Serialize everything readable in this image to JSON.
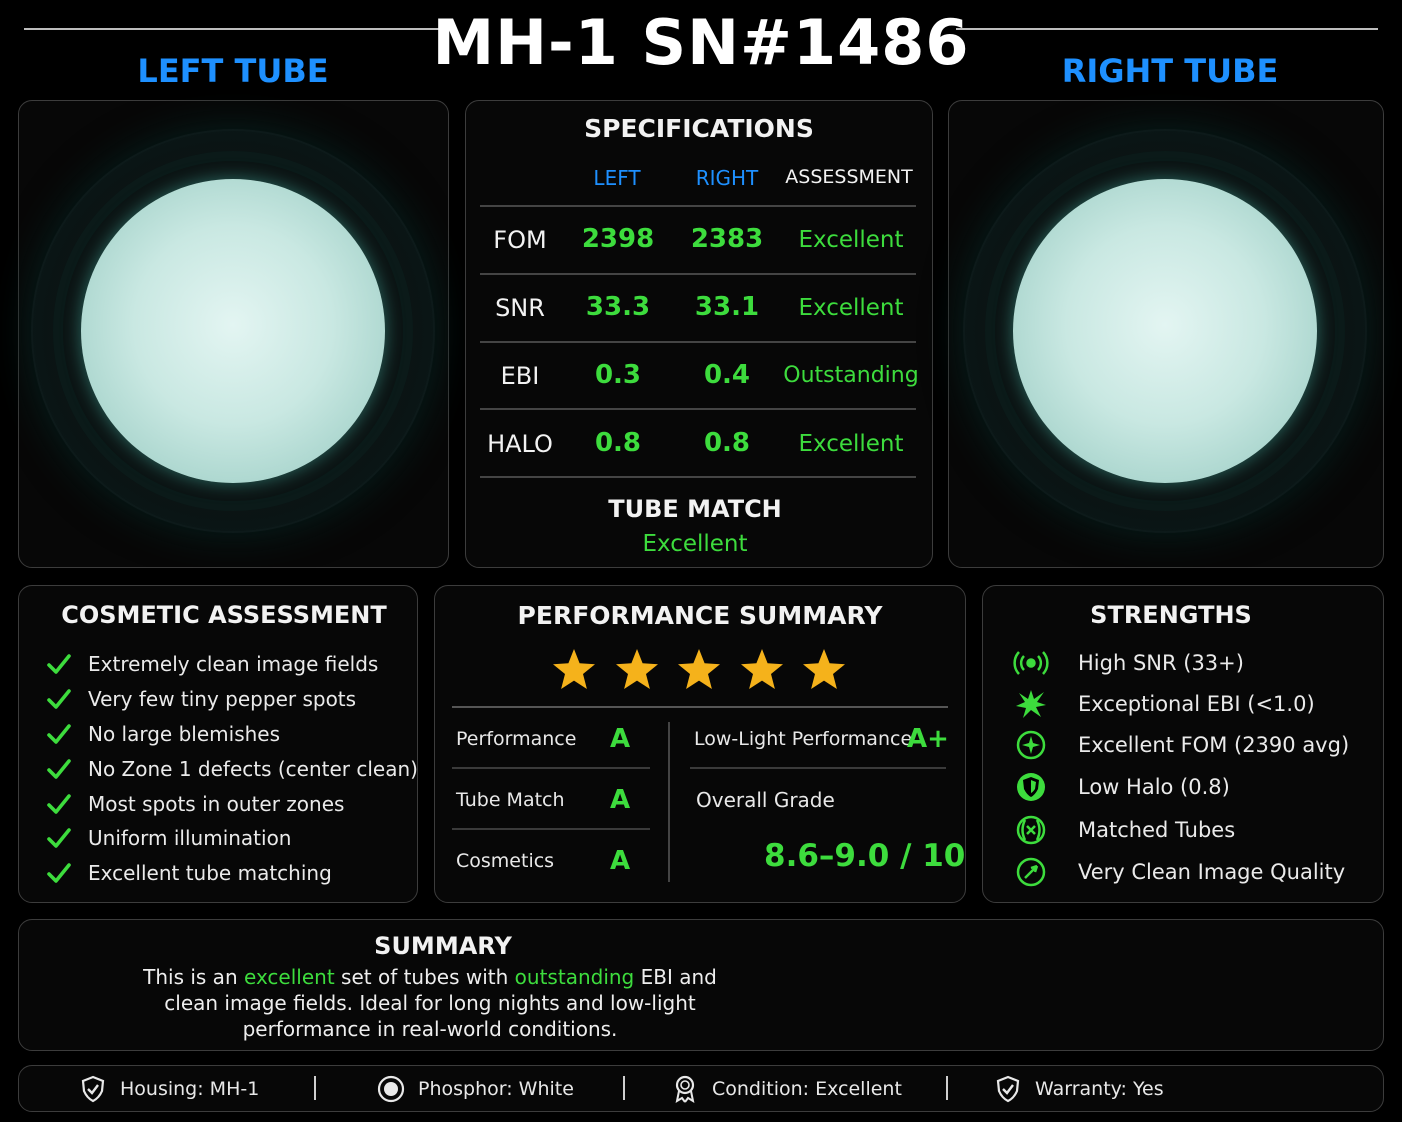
{
  "title": "MH-1 SN#1486",
  "left_tube_label": "LEFT TUBE",
  "right_tube_label": "RIGHT TUBE",
  "specs": {
    "heading": "SPECIFICATIONS",
    "col_left": "LEFT",
    "col_right": "RIGHT",
    "col_assessment": "ASSESSMENT",
    "rows": [
      {
        "label": "FOM",
        "left": "2398",
        "right": "2383",
        "assessment": "Excellent"
      },
      {
        "label": "SNR",
        "left": "33.3",
        "right": "33.1",
        "assessment": "Excellent"
      },
      {
        "label": "EBI",
        "left": "0.3",
        "right": "0.4",
        "assessment": "Outstanding"
      },
      {
        "label": "HALO",
        "left": "0.8",
        "right": "0.8",
        "assessment": "Excellent"
      }
    ],
    "tube_match_label": "TUBE MATCH",
    "tube_match_value": "Excellent"
  },
  "cosmetic": {
    "heading": "COSMETIC ASSESSMENT",
    "items": [
      "Extremely clean image fields",
      "Very few tiny pepper spots",
      "No large blemishes",
      "No Zone 1 defects (center clean)",
      "Most spots in outer zones",
      "Uniform illumination",
      "Excellent tube matching"
    ]
  },
  "performance": {
    "heading": "PERFORMANCE SUMMARY",
    "stars": 5,
    "grades_left": [
      {
        "label": "Performance",
        "grade": "A"
      },
      {
        "label": "Tube Match",
        "grade": "A"
      },
      {
        "label": "Cosmetics",
        "grade": "A"
      }
    ],
    "lowlight_label": "Low-Light Performance",
    "lowlight_grade": "A+",
    "overall_label": "Overall Grade",
    "overall_value": "8.6–9.0 / 10"
  },
  "strengths": {
    "heading": "STRENGTHS",
    "items": [
      {
        "icon": "signal-icon",
        "text": "High SNR (33+)"
      },
      {
        "icon": "burst-icon",
        "text": "Exceptional EBI (<1.0)"
      },
      {
        "icon": "compass-icon",
        "text": "Excellent FOM (2390 avg)"
      },
      {
        "icon": "shield-icon",
        "text": "Low Halo (0.8)"
      },
      {
        "icon": "match-icon",
        "text": "Matched Tubes"
      },
      {
        "icon": "gauge-icon",
        "text": "Very Clean Image Quality"
      }
    ]
  },
  "summary": {
    "heading": "SUMMARY",
    "p1": "This is an ",
    "hl1": "excellent",
    "p2": " set of tubes with ",
    "hl2": "outstanding",
    "p3": " EBI and clean image fields. Ideal for long nights and low-light performance in real-world conditions."
  },
  "footer": {
    "housing": "Housing: MH-1",
    "phosphor": "Phosphor: White",
    "condition": "Condition: Excellent",
    "warranty": "Warranty: Yes"
  },
  "colors": {
    "accent_blue": "#1e90ff",
    "accent_green": "#3ddc3d",
    "star": "#f5b21b"
  }
}
